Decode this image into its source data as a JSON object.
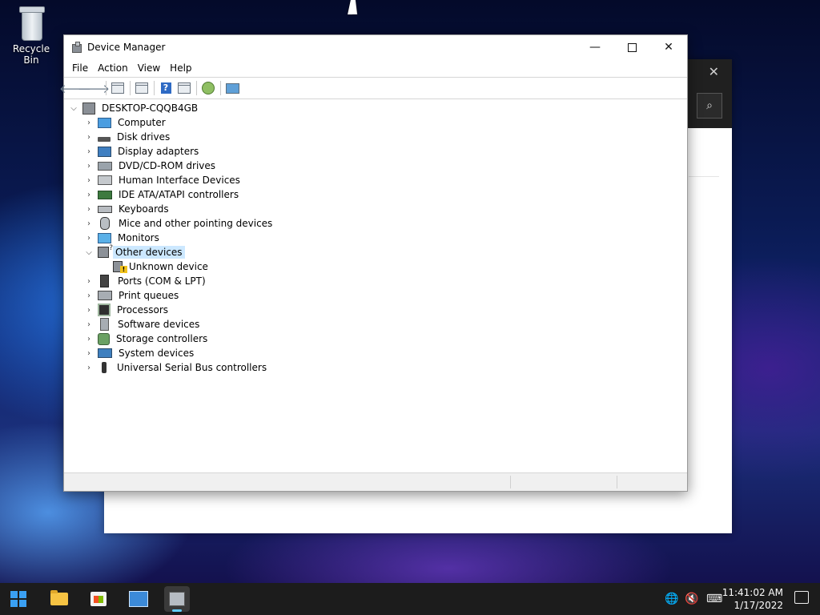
{
  "desktop": {
    "recycle_bin_label": "Recycle Bin"
  },
  "window": {
    "title": "Device Manager",
    "minimize_symbol": "—",
    "close_symbol": "✕",
    "menu": [
      "File",
      "Action",
      "View",
      "Help"
    ],
    "toolbar_icons": [
      "back-icon",
      "forward-icon",
      "show-hide-console-tree-icon",
      "properties-icon",
      "help-icon",
      "view-icon",
      "scan-hardware-icon",
      "monitor-icon"
    ]
  },
  "tree": {
    "root": "DESKTOP-CQQB4GB",
    "items": [
      {
        "label": "Computer",
        "icon": "computer-icon"
      },
      {
        "label": "Disk drives",
        "icon": "disk-drive-icon"
      },
      {
        "label": "Display adapters",
        "icon": "display-adapter-icon"
      },
      {
        "label": "DVD/CD-ROM drives",
        "icon": "dvd-drive-icon"
      },
      {
        "label": "Human Interface Devices",
        "icon": "hid-icon"
      },
      {
        "label": "IDE ATA/ATAPI controllers",
        "icon": "ide-controller-icon"
      },
      {
        "label": "Keyboards",
        "icon": "keyboard-icon"
      },
      {
        "label": "Mice and other pointing devices",
        "icon": "mouse-icon"
      },
      {
        "label": "Monitors",
        "icon": "monitor-icon"
      },
      {
        "label": "Other devices",
        "icon": "other-devices-icon",
        "expanded": true,
        "selected": true
      },
      {
        "label": "Unknown device",
        "icon": "unknown-device-warning-icon",
        "child": true
      },
      {
        "label": "Ports (COM & LPT)",
        "icon": "ports-icon"
      },
      {
        "label": "Print queues",
        "icon": "printer-icon"
      },
      {
        "label": "Processors",
        "icon": "processor-icon"
      },
      {
        "label": "Software devices",
        "icon": "software-device-icon"
      },
      {
        "label": "Storage controllers",
        "icon": "storage-controller-icon"
      },
      {
        "label": "System devices",
        "icon": "system-devices-icon"
      },
      {
        "label": "Universal Serial Bus controllers",
        "icon": "usb-icon"
      }
    ]
  },
  "background_window": {
    "close_symbol": "✕",
    "search_symbol": "⌕"
  },
  "taskbar": {
    "apps": [
      "start-icon",
      "file-explorer-icon",
      "microsoft-store-icon",
      "control-panel-icon",
      "device-manager-icon"
    ],
    "time": "11:41:02 AM",
    "date": "1/17/2022"
  },
  "colors": {
    "selection": "#cce8ff",
    "taskbar": "#1c1c1c",
    "accent": "#60cdff"
  }
}
